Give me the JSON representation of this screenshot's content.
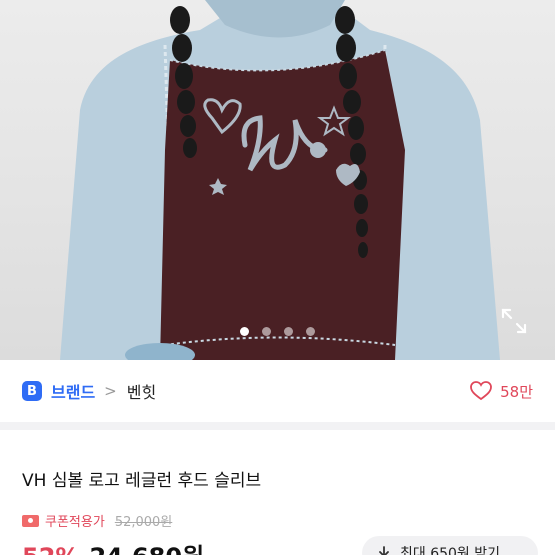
{
  "gallery": {
    "dots": [
      true,
      false,
      false,
      false
    ]
  },
  "brand": {
    "badge": "B",
    "label": "브랜드",
    "chevron": ">",
    "name": "벤힛"
  },
  "like": {
    "count": "58만"
  },
  "product": {
    "title": "VH 심볼 로고 레글런 후드 슬리브",
    "coupon_label": "쿠폰적용가",
    "original_price": "52,000원",
    "discount": "52%",
    "price": "24,680원"
  },
  "coupon_button": {
    "label": "최대 650원 받기"
  },
  "colors": {
    "accent": "#2f6cf5",
    "sale": "#e0475a",
    "garment": "#4a2024",
    "sleeve": "#b7cddc"
  }
}
